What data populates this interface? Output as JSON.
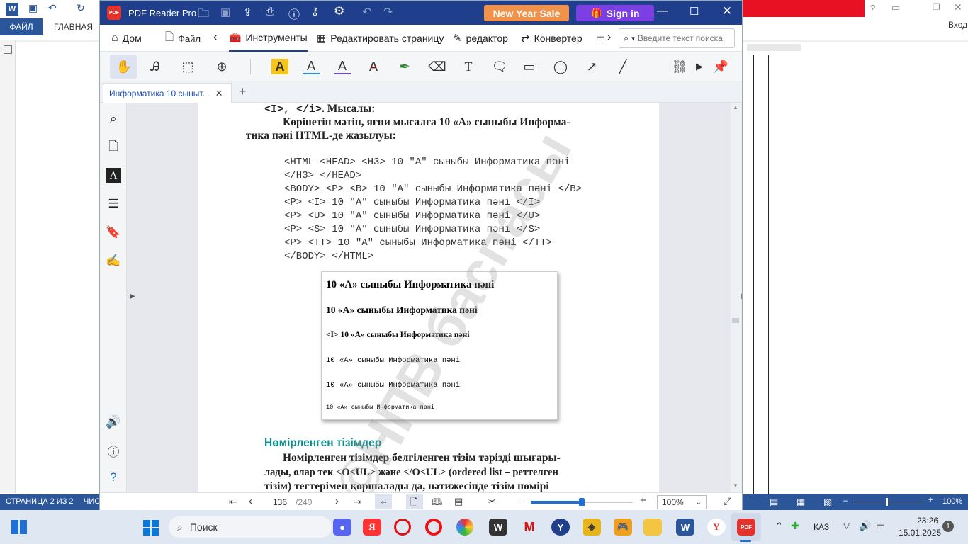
{
  "word": {
    "file_tab": "ФАЙЛ",
    "home_tab": "ГЛАВНАЯ",
    "signin": "Вход",
    "status_page": "СТРАНИЦА 2 ИЗ 2",
    "status_words": "ЧИС",
    "zoom": "100%"
  },
  "pdf": {
    "app_title": "PDF Reader Pro",
    "new_year_sale": "New Year Sale",
    "sign_in": "Sign in",
    "nav": {
      "home": "Дом",
      "file": "Файл",
      "tools": "Инструменты",
      "edit_page": "Редактировать страницу",
      "editor": "редактор",
      "converter": "Конвертер",
      "search_placeholder": "Введите текст поиска"
    },
    "tab_title": "Информатика 10 сыныт...",
    "page": {
      "line1_code": "<I>, </i>",
      "line1_rest": ". Мысалы:",
      "para1_line1": "Көрінетін мәтін, яғни мысалға 10 «А» сыныбы Информа-",
      "para1_line2": "тика пәні HTML-де жазылуы:",
      "code": [
        "<HTML <HEAD> <H3> 10 \"A\" сыныбы Информатика пәні",
        "</H3> </HEAD>",
        "<BODY> <P> <B> 10 \"A\" сыныбы Информатика пәні </B>",
        "<P> <I> 10 \"A\" сыныбы Информатика пәні </I>",
        "<P> <U> 10 \"A\" сыныбы Информатика пәні </U>",
        "<P> <S> 10 \"A\" сыныбы Информатика пәні </S>",
        "<P> <TT> 10 \"A\" сыныбы Информатика пәні </TT>",
        "</BODY> </HTML>"
      ],
      "sample": [
        "10 «А» сыныбы Информатика пәні",
        "10 «А» сыныбы Информатика пәні",
        "<I> 10 «А» сыныбы Информатика пәні",
        "10 «А» сыныбы Информатика пәні",
        "10 «А» сыныбы Информатика пәні",
        "10 «А» сыныбы Информатика пәні"
      ],
      "heading": "Нөмірленген тізімдер",
      "para2_line1": "Нөмірленген тізімдер белгіленген тізім тәрізді шығары-",
      "para2_line2": "лады, олар тек <O<UL> және </O<UL> (ordered list – реттелген",
      "para2_line3": "тізім) тегтерімен қоршалады да, нәтижесінде тізім нөмірі",
      "watermark": "©НПВ баспасы"
    },
    "bottom": {
      "current_page": "136",
      "total_pages": "/240",
      "zoom": "100%"
    }
  },
  "taskbar": {
    "search": "Поиск",
    "lang": "ҚАЗ",
    "time": "23:26",
    "date": "15.01.2025",
    "notif": "1"
  },
  "colors": {
    "pdf_title": "#1f3f8c",
    "word_blue": "#2b579a",
    "heading_teal": "#138c8c",
    "sale_orange": "#f0924a",
    "signin_purple": "#7b3fe4"
  }
}
